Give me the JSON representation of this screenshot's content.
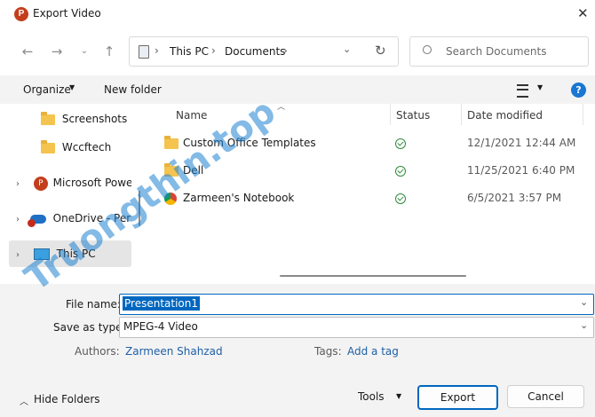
{
  "window": {
    "title": "Export Video"
  },
  "address_bar": {
    "segments": [
      "This PC",
      "Documents"
    ]
  },
  "search": {
    "placeholder": "Search Documents"
  },
  "toolbar": {
    "organize": "Organize",
    "new_folder": "New folder",
    "help": "?"
  },
  "nav_pane": {
    "items": [
      {
        "label": "Screenshots"
      },
      {
        "label": "Wccftech"
      },
      {
        "label": "Microsoft Power"
      },
      {
        "label": "OneDrive - Perso"
      },
      {
        "label": "This PC"
      }
    ]
  },
  "file_list": {
    "columns": [
      "Name",
      "Status",
      "Date modified"
    ],
    "rows": [
      {
        "name": "Custom Office Templates",
        "date": "12/1/2021 12:44 AM"
      },
      {
        "name": "Dell",
        "date": "11/25/2021 6:40 PM"
      },
      {
        "name": "Zarmeen's Notebook",
        "date": "6/5/2021 3:57 PM"
      }
    ]
  },
  "form": {
    "file_name_label": "File name:",
    "file_name_value": "Presentation1",
    "save_type_label": "Save as type:",
    "save_type_value": "MPEG-4 Video",
    "authors_label": "Authors:",
    "authors_value": "Zarmeen Shahzad",
    "tags_label": "Tags:",
    "tags_value": "Add a tag"
  },
  "footer": {
    "hide_folders": "Hide Folders",
    "tools": "Tools",
    "export": "Export",
    "cancel": "Cancel"
  },
  "watermark": {
    "text": "Truongthin.top"
  },
  "colors": {
    "accent": "#0067c0",
    "toolbar_bg": "#f3f3f3",
    "selected_nav": "#e5e5e5",
    "check": "#2e8b3a"
  }
}
